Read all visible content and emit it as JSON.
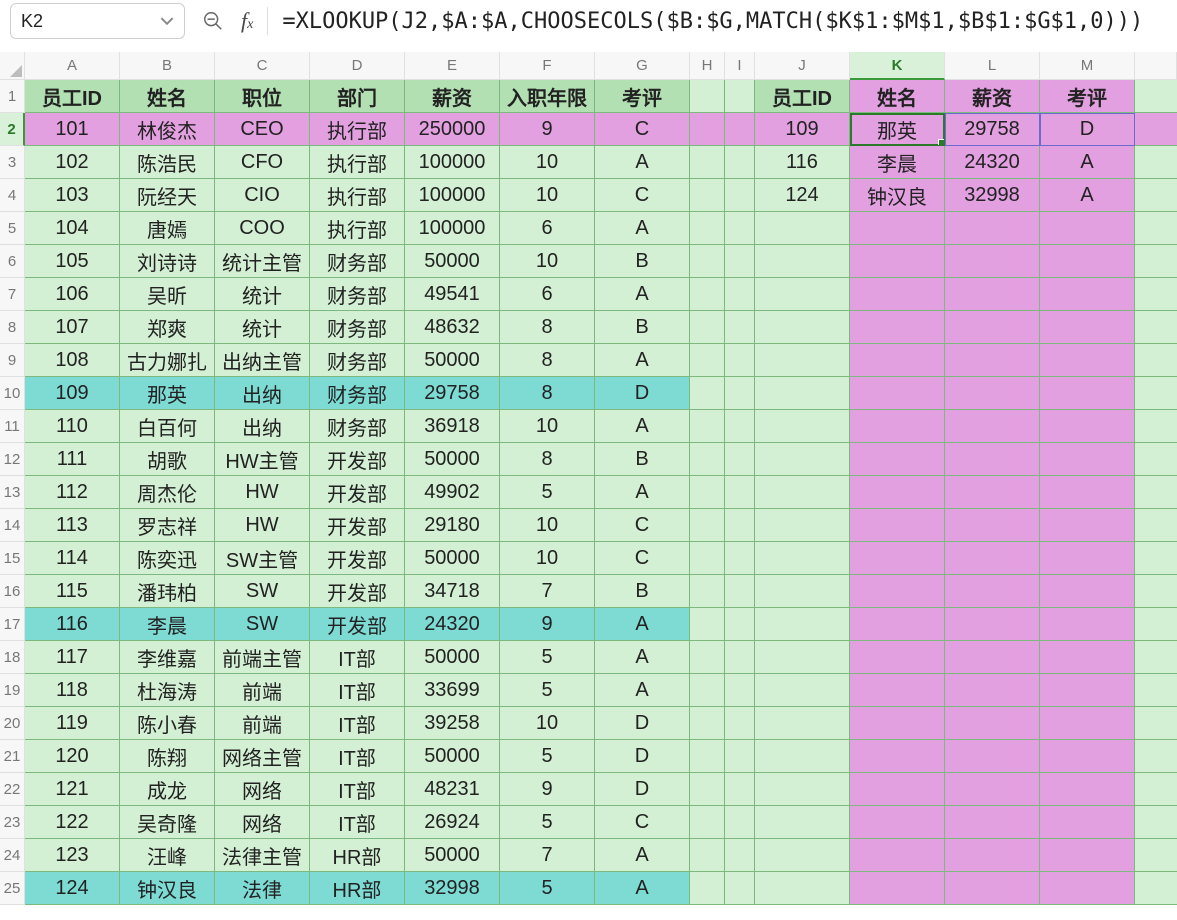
{
  "nameBox": "K2",
  "formula": "=XLOOKUP(J2,$A:$A,CHOOSECOLS($B:$G,MATCH($K$1:$M$1,$B$1:$G$1,0)))",
  "columns": [
    "A",
    "B",
    "C",
    "D",
    "E",
    "F",
    "G",
    "H",
    "I",
    "J",
    "K",
    "L",
    "M"
  ],
  "headers": {
    "A": "员工ID",
    "B": "姓名",
    "C": "职位",
    "D": "部门",
    "E": "薪资",
    "F": "入职年限",
    "G": "考评",
    "J": "员工ID",
    "K": "姓名",
    "L": "薪资",
    "M": "考评"
  },
  "rows": [
    {
      "n": 2,
      "A": "101",
      "B": "林俊杰",
      "C": "CEO",
      "D": "执行部",
      "E": "250000",
      "F": "9",
      "G": "C",
      "J": "109",
      "K": "那英",
      "L": "29758",
      "M": "D"
    },
    {
      "n": 3,
      "A": "102",
      "B": "陈浩民",
      "C": "CFO",
      "D": "执行部",
      "E": "100000",
      "F": "10",
      "G": "A",
      "J": "116",
      "K": "李晨",
      "L": "24320",
      "M": "A"
    },
    {
      "n": 4,
      "A": "103",
      "B": "阮经天",
      "C": "CIO",
      "D": "执行部",
      "E": "100000",
      "F": "10",
      "G": "C",
      "J": "124",
      "K": "钟汉良",
      "L": "32998",
      "M": "A"
    },
    {
      "n": 5,
      "A": "104",
      "B": "唐嫣",
      "C": "COO",
      "D": "执行部",
      "E": "100000",
      "F": "6",
      "G": "A"
    },
    {
      "n": 6,
      "A": "105",
      "B": "刘诗诗",
      "C": "统计主管",
      "D": "财务部",
      "E": "50000",
      "F": "10",
      "G": "B"
    },
    {
      "n": 7,
      "A": "106",
      "B": "吴昕",
      "C": "统计",
      "D": "财务部",
      "E": "49541",
      "F": "6",
      "G": "A"
    },
    {
      "n": 8,
      "A": "107",
      "B": "郑爽",
      "C": "统计",
      "D": "财务部",
      "E": "48632",
      "F": "8",
      "G": "B"
    },
    {
      "n": 9,
      "A": "108",
      "B": "古力娜扎",
      "C": "出纳主管",
      "D": "财务部",
      "E": "50000",
      "F": "8",
      "G": "A"
    },
    {
      "n": 10,
      "A": "109",
      "B": "那英",
      "C": "出纳",
      "D": "财务部",
      "E": "29758",
      "F": "8",
      "G": "D",
      "hl": true
    },
    {
      "n": 11,
      "A": "110",
      "B": "白百何",
      "C": "出纳",
      "D": "财务部",
      "E": "36918",
      "F": "10",
      "G": "A"
    },
    {
      "n": 12,
      "A": "111",
      "B": "胡歌",
      "C": "HW主管",
      "D": "开发部",
      "E": "50000",
      "F": "8",
      "G": "B"
    },
    {
      "n": 13,
      "A": "112",
      "B": "周杰伦",
      "C": "HW",
      "D": "开发部",
      "E": "49902",
      "F": "5",
      "G": "A"
    },
    {
      "n": 14,
      "A": "113",
      "B": "罗志祥",
      "C": "HW",
      "D": "开发部",
      "E": "29180",
      "F": "10",
      "G": "C"
    },
    {
      "n": 15,
      "A": "114",
      "B": "陈奕迅",
      "C": "SW主管",
      "D": "开发部",
      "E": "50000",
      "F": "10",
      "G": "C"
    },
    {
      "n": 16,
      "A": "115",
      "B": "潘玮柏",
      "C": "SW",
      "D": "开发部",
      "E": "34718",
      "F": "7",
      "G": "B"
    },
    {
      "n": 17,
      "A": "116",
      "B": "李晨",
      "C": "SW",
      "D": "开发部",
      "E": "24320",
      "F": "9",
      "G": "A",
      "hl": true
    },
    {
      "n": 18,
      "A": "117",
      "B": "李维嘉",
      "C": "前端主管",
      "D": "IT部",
      "E": "50000",
      "F": "5",
      "G": "A"
    },
    {
      "n": 19,
      "A": "118",
      "B": "杜海涛",
      "C": "前端",
      "D": "IT部",
      "E": "33699",
      "F": "5",
      "G": "A"
    },
    {
      "n": 20,
      "A": "119",
      "B": "陈小春",
      "C": "前端",
      "D": "IT部",
      "E": "39258",
      "F": "10",
      "G": "D"
    },
    {
      "n": 21,
      "A": "120",
      "B": "陈翔",
      "C": "网络主管",
      "D": "IT部",
      "E": "50000",
      "F": "5",
      "G": "D"
    },
    {
      "n": 22,
      "A": "121",
      "B": "成龙",
      "C": "网络",
      "D": "IT部",
      "E": "48231",
      "F": "9",
      "G": "D"
    },
    {
      "n": 23,
      "A": "122",
      "B": "吴奇隆",
      "C": "网络",
      "D": "IT部",
      "E": "26924",
      "F": "5",
      "G": "C"
    },
    {
      "n": 24,
      "A": "123",
      "B": "汪峰",
      "C": "法律主管",
      "D": "HR部",
      "E": "50000",
      "F": "7",
      "G": "A"
    },
    {
      "n": 25,
      "A": "124",
      "B": "钟汉良",
      "C": "法律",
      "D": "HR部",
      "E": "32998",
      "F": "5",
      "G": "A",
      "hl": true
    }
  ],
  "selectedCell": "K2",
  "highlightCol": "K",
  "highlightRow": 2
}
